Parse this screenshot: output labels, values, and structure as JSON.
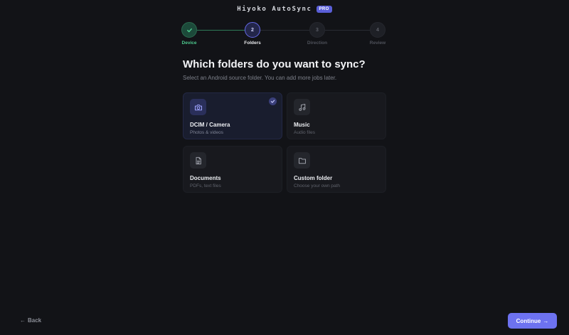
{
  "header": {
    "app_title": "Hiyoko AutoSync",
    "badge": "PRO"
  },
  "stepper": {
    "steps": [
      {
        "number": "✓",
        "label": "Device",
        "state": "done"
      },
      {
        "number": "2",
        "label": "Folders",
        "state": "active"
      },
      {
        "number": "3",
        "label": "Direction",
        "state": "todo"
      },
      {
        "number": "4",
        "label": "Review",
        "state": "todo"
      }
    ]
  },
  "main": {
    "title": "Which folders do you want to sync?",
    "subtitle": "Select an Android source folder. You can add more jobs later.",
    "folders": [
      {
        "title": "DCIM / Camera",
        "subtitle": "Photos & videos",
        "icon": "camera-icon",
        "selected": true
      },
      {
        "title": "Music",
        "subtitle": "Audio files",
        "icon": "music-icon",
        "selected": false
      },
      {
        "title": "Documents",
        "subtitle": "PDFs, text files",
        "icon": "document-icon",
        "selected": false
      },
      {
        "title": "Custom folder",
        "subtitle": "Choose your own path",
        "icon": "folder-icon",
        "selected": false
      }
    ]
  },
  "footer": {
    "back_label": "Back",
    "back_arrow": "←",
    "continue_label": "Continue",
    "continue_arrow": "→"
  },
  "colors": {
    "accent": "#6d72f0",
    "success": "#4ecb8f",
    "background": "#121317"
  }
}
